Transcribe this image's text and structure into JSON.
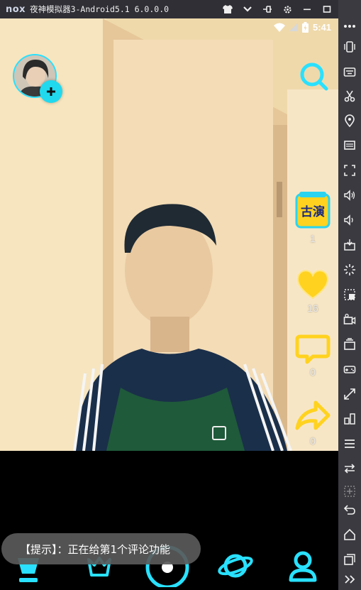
{
  "window": {
    "logo": "nox",
    "title": "夜神模拟器3-Android5.1 6.0.0.0"
  },
  "statusbar": {
    "time": "5:41"
  },
  "side_actions": {
    "boost_count": "1",
    "like_count": "16",
    "comment_count": "0",
    "share_count": "0",
    "boost_badge": "古演"
  },
  "toast": {
    "text": "【提示】：正在给第1个评论功能"
  },
  "colors": {
    "accent": "#29e1ff",
    "gold": "#ffd21f",
    "titlebar": "#2f2f35",
    "toolbar": "#3a3a40"
  },
  "icons": {
    "titlebar": [
      "shirt-icon",
      "chevron-down-icon",
      "pin-icon",
      "gear-icon",
      "minimize-icon",
      "maximize-icon",
      "close-icon"
    ],
    "toolbar": [
      "more-icon",
      "shake-icon",
      "keyboard-icon",
      "scissors-icon",
      "location-icon",
      "screen-icon",
      "fullscreen-icon",
      "volume-up-icon",
      "volume-down-icon",
      "apk-icon",
      "loading-icon",
      "grid-icon",
      "camera-icon",
      "multi-instance-icon",
      "gamepad-icon",
      "resize-icon",
      "layout-icon",
      "menu-icon",
      "swap-icon",
      "add-icon",
      "back-icon",
      "home-icon",
      "recent-icon",
      "expand-icon"
    ]
  }
}
